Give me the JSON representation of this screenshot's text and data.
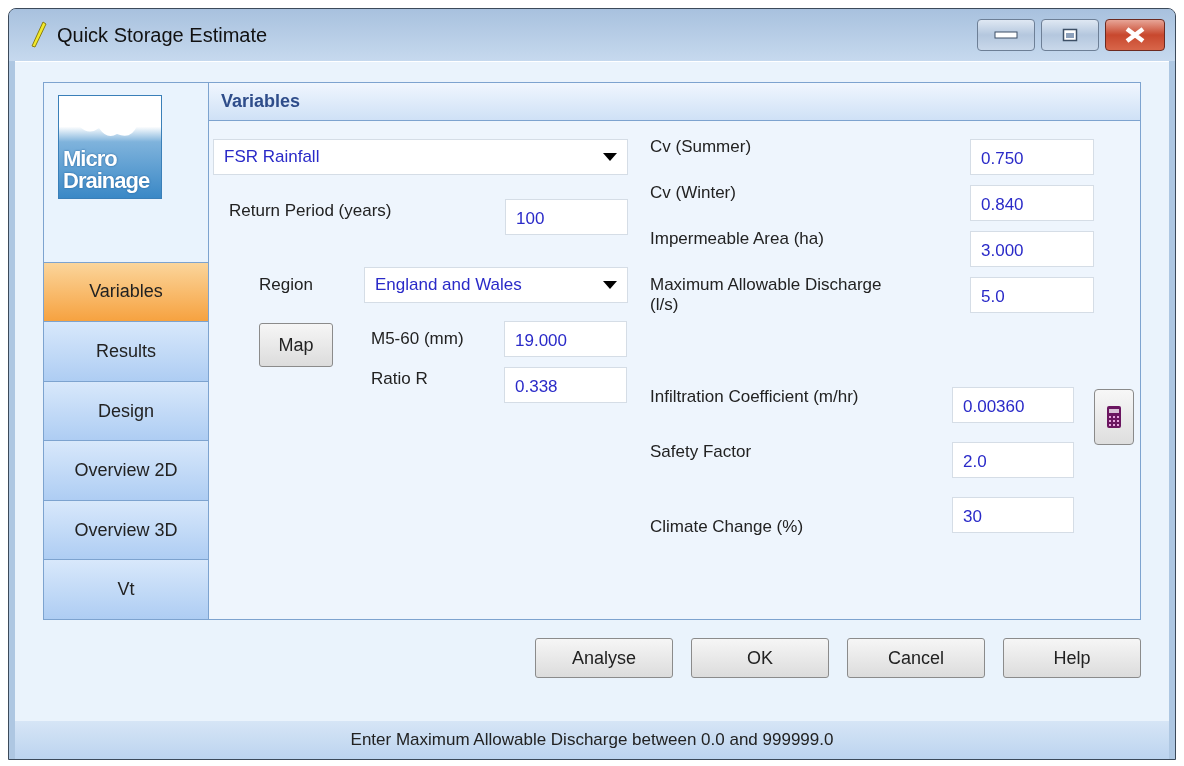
{
  "window": {
    "title": "Quick Storage Estimate"
  },
  "logo": {
    "lines": [
      "Micro",
      "Drainage"
    ]
  },
  "sidebar": {
    "items": [
      {
        "label": "Variables",
        "selected": true
      },
      {
        "label": "Results",
        "selected": false
      },
      {
        "label": "Design",
        "selected": false
      },
      {
        "label": "Overview 2D",
        "selected": false
      },
      {
        "label": "Overview 3D",
        "selected": false
      },
      {
        "label": "Vt",
        "selected": false
      }
    ]
  },
  "panel": {
    "title": "Variables"
  },
  "rainfall": {
    "value": "FSR Rainfall"
  },
  "return_period": {
    "label": "Return Period (years)",
    "value": "100"
  },
  "region": {
    "label": "Region",
    "value": "England and Wales"
  },
  "map_button": "Map",
  "m5_60": {
    "label": "M5-60 (mm)",
    "value": "19.000"
  },
  "ratio_r": {
    "label": "Ratio R",
    "value": "0.338"
  },
  "parameters": [
    {
      "label": "Cv (Summer)",
      "value": "0.750"
    },
    {
      "label": "Cv (Winter)",
      "value": "0.840"
    },
    {
      "label": "Impermeable Area (ha)",
      "value": "3.000"
    },
    {
      "label": "Maximum Allowable Discharge (l/s)",
      "value": "5.0"
    }
  ],
  "infiltration": [
    {
      "label": "Infiltration Coefficient (m/hr)",
      "value": "0.00360"
    },
    {
      "label": "Safety Factor",
      "value": "2.0"
    },
    {
      "label": "Climate Change (%)",
      "value": "30"
    }
  ],
  "buttons": [
    "Analyse",
    "OK",
    "Cancel",
    "Help"
  ],
  "status_bar": "Enter Maximum Allowable Discharge between 0.0 and 999999.0"
}
